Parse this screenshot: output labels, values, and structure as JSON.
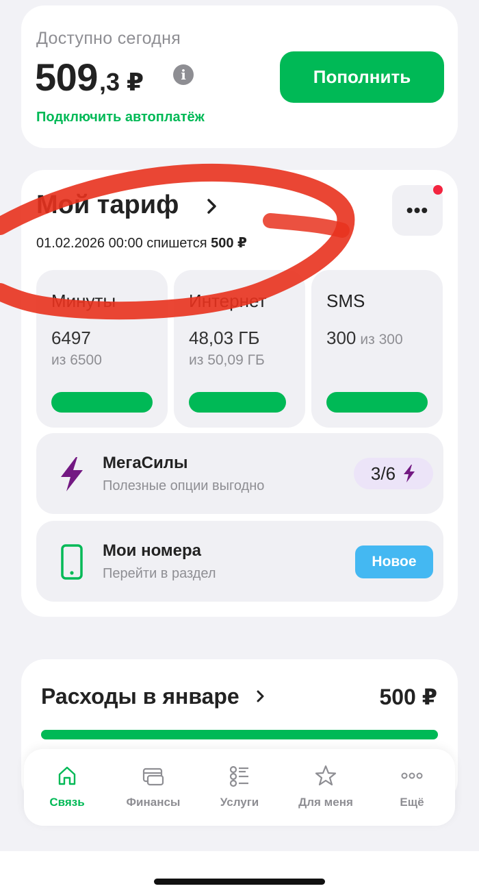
{
  "balance": {
    "label": "Доступно сегодня",
    "amount_int": "509",
    "amount_frac": ",3 ₽",
    "info_icon": "i",
    "topup_label": "Пополнить",
    "autopay_label": "Подключить автоплатёж"
  },
  "tariff": {
    "title": "Мой тариф",
    "charge_prefix": "01.02.2026 00:00 спишется",
    "charge_amount": "500 ₽",
    "more_label": "•••",
    "tiles": [
      {
        "title": "Минуты",
        "value": "6497",
        "sub": "из 6500",
        "remaining_fraction": 0.9995
      },
      {
        "title": "Интернет",
        "value": "48,03 ГБ",
        "sub": "из 50,09 ГБ",
        "remaining_fraction": 0.959
      },
      {
        "title": "SMS",
        "value": "300",
        "sub": "из 300",
        "remaining_fraction": 1.0
      }
    ],
    "megasily": {
      "title": "МегаСилы",
      "subtitle": "Полезные опции выгодно",
      "badge": "3/6"
    },
    "numbers": {
      "title": "Мои номера",
      "subtitle": "Перейти в раздел",
      "badge": "Новое"
    }
  },
  "expenses": {
    "title": "Расходы в январе",
    "amount": "500 ₽",
    "fill_fraction": 1.0
  },
  "tabs": [
    {
      "label": "Связь",
      "icon": "home-icon",
      "active": true
    },
    {
      "label": "Финансы",
      "icon": "card-icon",
      "active": false
    },
    {
      "label": "Услуги",
      "icon": "list-icon",
      "active": false
    },
    {
      "label": "Для меня",
      "icon": "star-icon",
      "active": false
    },
    {
      "label": "Ещё",
      "icon": "more-icon",
      "active": false
    }
  ],
  "colors": {
    "brand_green": "#00b956",
    "accent_purple": "#731982",
    "badge_blue": "#44b8f2",
    "alert_red": "#f3243f",
    "annotation_red": "#e8321e"
  }
}
